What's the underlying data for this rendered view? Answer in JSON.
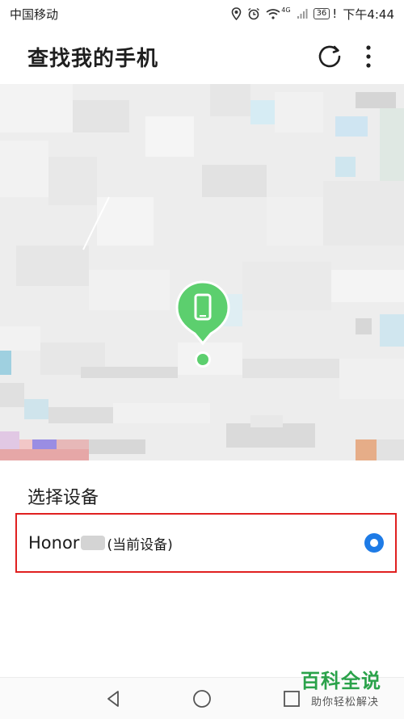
{
  "status_bar": {
    "carrier": "中国移动",
    "network": "4G",
    "battery": "36",
    "alert": "!",
    "time": "下午4:44"
  },
  "app_bar": {
    "title": "查找我的手机"
  },
  "section": {
    "title": "选择设备"
  },
  "device": {
    "name": "Honor",
    "tag": "(当前设备)",
    "selected": true
  },
  "colors": {
    "accent": "#1e7be6",
    "pin": "#5ccf6e",
    "highlight": "#e02020",
    "watermark": "#2aa24a"
  },
  "watermark": {
    "title": "百科全说",
    "subtitle": "助你轻松解决"
  }
}
